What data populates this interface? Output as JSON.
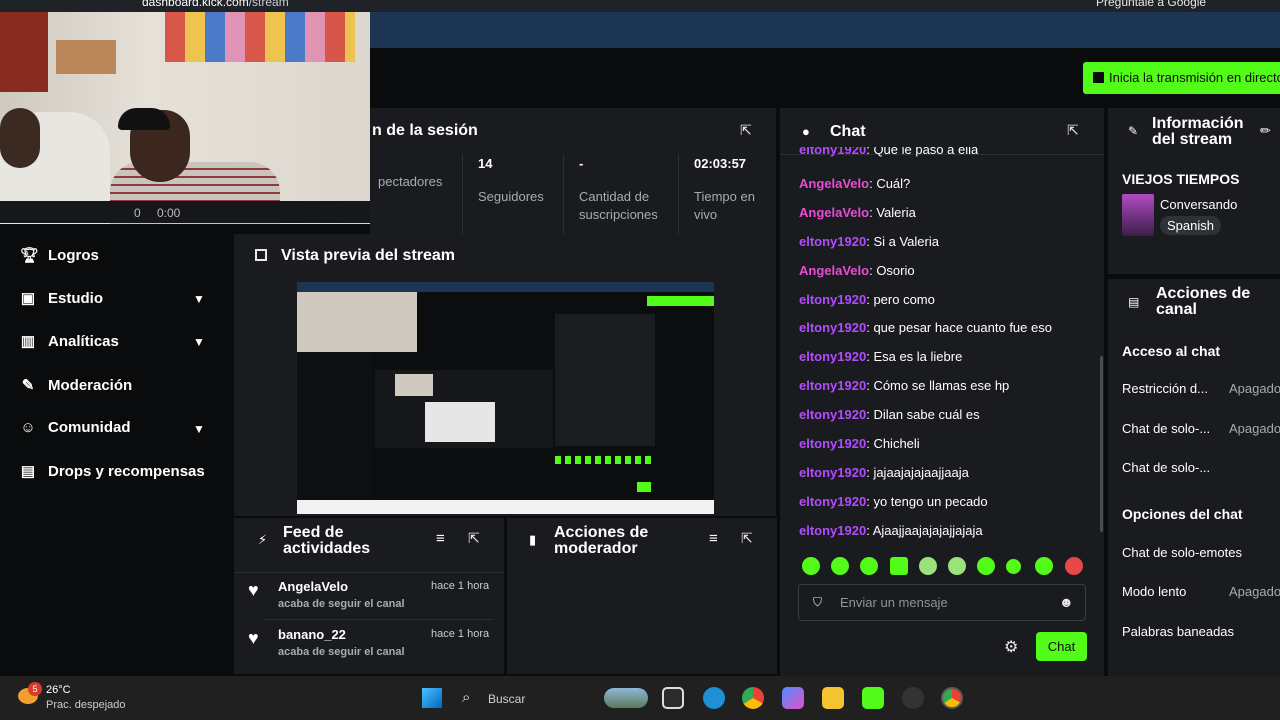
{
  "browser": {
    "url_host": "dashboard.kick.com",
    "url_path": "/stream",
    "google_button": "Pregúntale a Google"
  },
  "cta": {
    "label": "Inicia la transmisión en directo"
  },
  "webcam": {
    "volume": "0",
    "time": "0:00"
  },
  "session": {
    "title": "Información de la sesión",
    "title_visible": "n de la sesión",
    "stats": [
      {
        "value": "",
        "label": "Espectadores",
        "label_visible": "pectadores"
      },
      {
        "value": "14",
        "label": "Seguidores"
      },
      {
        "value": "-",
        "label": "Cantidad de suscripciones"
      },
      {
        "value": "02:03:57",
        "label": "Tiempo en vivo"
      }
    ]
  },
  "sidebar": {
    "items": [
      {
        "label": "Logros",
        "icon": "trophy-icon"
      },
      {
        "label": "Estudio",
        "icon": "studio-icon",
        "expandable": true
      },
      {
        "label": "Analíticas",
        "icon": "analytics-icon",
        "expandable": true
      },
      {
        "label": "Moderación",
        "icon": "wrench-icon"
      },
      {
        "label": "Comunidad",
        "icon": "community-icon",
        "expandable": true
      },
      {
        "label": "Drops y recompensas",
        "icon": "drops-icon"
      }
    ]
  },
  "preview": {
    "title": "Vista previa del stream"
  },
  "feed": {
    "title": "Feed de actividades",
    "items": [
      {
        "name": "AngelaVelo",
        "action": "acaba de seguir el canal",
        "time": "hace 1 hora"
      },
      {
        "name": "banano_22",
        "action": "acaba de seguir el canal",
        "time": "hace 1 hora"
      }
    ]
  },
  "mod_actions": {
    "title": "Acciones de moderador"
  },
  "chat": {
    "title": "Chat",
    "messages": [
      {
        "user": "eltony1920",
        "text": "Que le paso a ella",
        "color": "#b44bff"
      },
      {
        "user": "AngelaVelo",
        "text": "Cuál?",
        "color": "#e84dd6"
      },
      {
        "user": "AngelaVelo",
        "text": "Valeria",
        "color": "#e84dd6"
      },
      {
        "user": "eltony1920",
        "text": "Si a Valeria",
        "color": "#b44bff"
      },
      {
        "user": "AngelaVelo",
        "text": "Osorio",
        "color": "#e84dd6"
      },
      {
        "user": "eltony1920",
        "text": "pero como",
        "color": "#b44bff"
      },
      {
        "user": "eltony1920",
        "text": "que pesar hace cuanto fue eso",
        "color": "#b44bff"
      },
      {
        "user": "eltony1920",
        "text": "Esa es la liebre",
        "color": "#b44bff"
      },
      {
        "user": "eltony1920",
        "text": "Cómo se llamas ese hp",
        "color": "#b44bff"
      },
      {
        "user": "eltony1920",
        "text": "Dilan sabe cuál es",
        "color": "#b44bff"
      },
      {
        "user": "eltony1920",
        "text": "Chicheli",
        "color": "#b44bff"
      },
      {
        "user": "eltony1920",
        "text": "jajaajajajaajjaaja",
        "color": "#b44bff"
      },
      {
        "user": "eltony1920",
        "text": "yo tengo un pecado",
        "color": "#b44bff"
      },
      {
        "user": "eltony1920",
        "text": "Ajaajjaajajajajjajaja",
        "color": "#b44bff"
      }
    ],
    "input_placeholder": "Enviar un mensaje",
    "send_label": "Chat"
  },
  "stream_info": {
    "title": "Información del stream",
    "stream_title": "VIEJOS TIEMPOS",
    "category": "Conversando",
    "language": "Spanish"
  },
  "channel_actions": {
    "title": "Acciones de canal",
    "sections": [
      {
        "title": "Acceso al chat",
        "rows": [
          {
            "label": "Restricción d...",
            "value": "Apagado"
          },
          {
            "label": "Chat de solo-...",
            "value": "Apagado"
          },
          {
            "label": "Chat de solo-...",
            "value": ""
          }
        ]
      },
      {
        "title": "Opciones del chat",
        "rows": [
          {
            "label": "Chat de solo-emotes",
            "value": ""
          },
          {
            "label": "Modo lento",
            "value": "Apagado"
          },
          {
            "label": "Palabras baneadas",
            "value": ""
          }
        ]
      }
    ]
  },
  "taskbar": {
    "weather": {
      "temp": "26°C",
      "desc": "Prac. despejado",
      "badge": "5"
    },
    "search": "Buscar"
  },
  "colors": {
    "accent": "#53fc18",
    "panel": "#191b1f",
    "username": "#b44bff"
  }
}
